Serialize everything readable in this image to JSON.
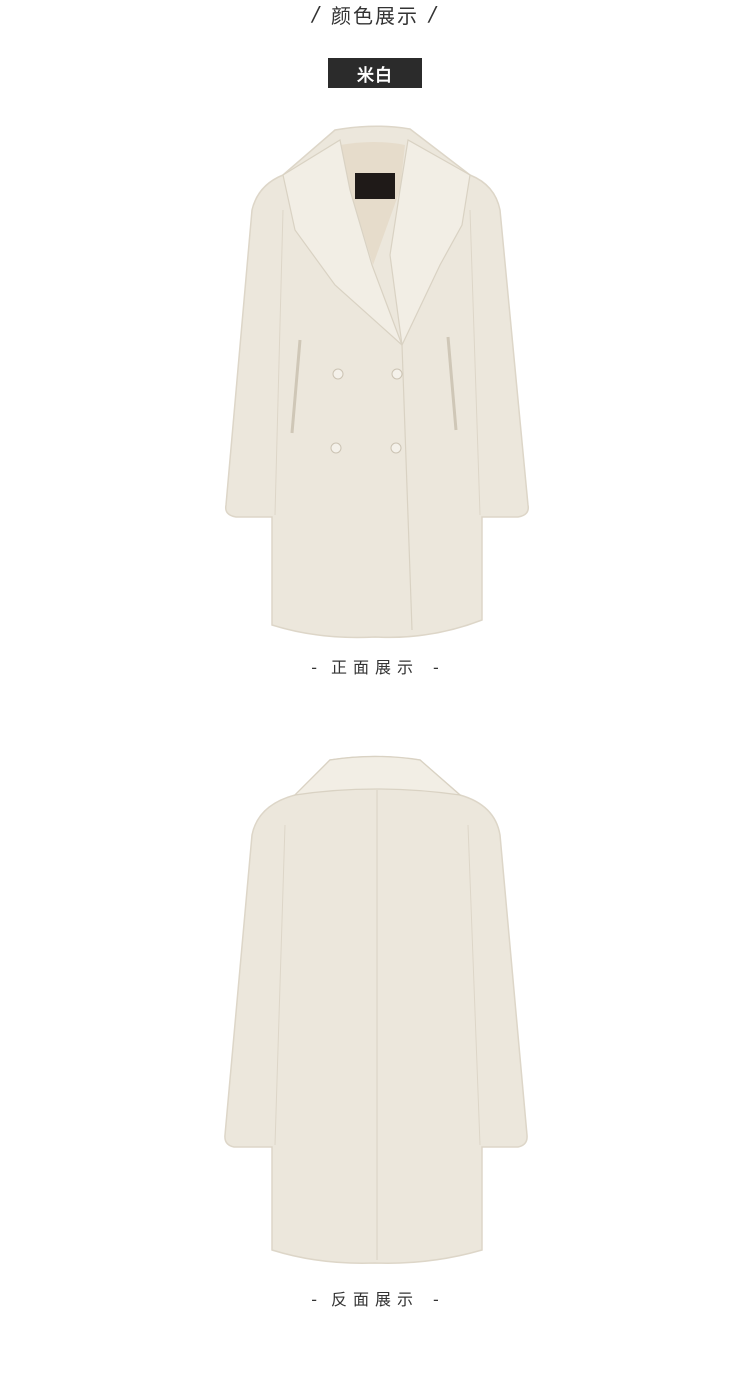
{
  "header": {
    "title": "颜色展示",
    "slash_left": "/",
    "slash_right": "/"
  },
  "color_badge": {
    "label": "米白"
  },
  "front": {
    "caption": "正面展示",
    "dash_left": "-",
    "dash_right": "-"
  },
  "back": {
    "caption": "反面展示",
    "dash_left": "-",
    "dash_right": "-"
  },
  "colors": {
    "coat": "#ece7dc",
    "coat_shadow": "#ddd6c8",
    "coat_lining": "#e6dccb",
    "badge_bg": "#2b2b2b"
  }
}
